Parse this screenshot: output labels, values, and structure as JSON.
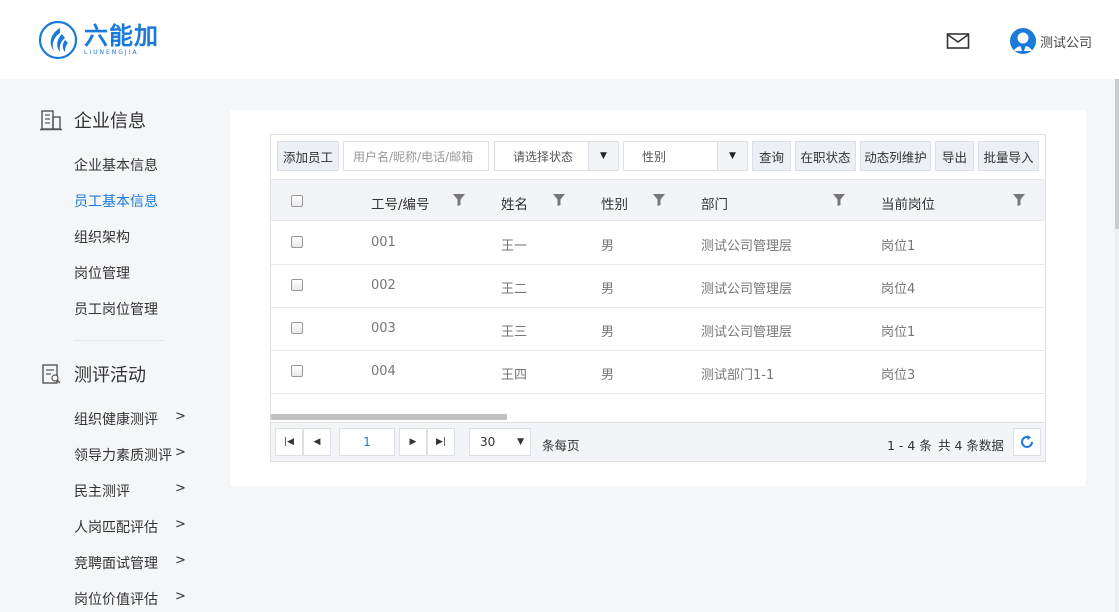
{
  "header": {
    "logo_cn": "六能加",
    "logo_en": "LIUNENGJIA",
    "user_name": "测试公司"
  },
  "sidebar": {
    "sections": [
      {
        "title": "企业信息",
        "icon": "building-icon"
      },
      {
        "title": "测评活动",
        "icon": "document-icon"
      }
    ],
    "company_items": [
      "企业基本信息",
      "员工基本信息",
      "组织架构",
      "岗位管理",
      "员工岗位管理"
    ],
    "active_item": "员工基本信息",
    "activity_items": [
      "组织健康测评",
      "领导力素质测评",
      "民主测评",
      "人岗匹配评估",
      "竞聘面试管理",
      "岗位价值评估"
    ]
  },
  "toolbar": {
    "add_employee": "添加员工",
    "search_placeholder": "用户名/昵称/电话/邮箱",
    "status_select": "请选择状态",
    "gender_select": "性别",
    "query": "查询",
    "employment_status": "在职状态",
    "dynamic_columns": "动态列维护",
    "export": "导出",
    "bulk_import": "批量导入"
  },
  "table": {
    "columns": [
      "工号/编号",
      "姓名",
      "性别",
      "部门",
      "当前岗位"
    ],
    "rows": [
      {
        "id": "001",
        "name": "王一",
        "gender": "男",
        "dept": "测试公司管理层",
        "position": "岗位1"
      },
      {
        "id": "002",
        "name": "王二",
        "gender": "男",
        "dept": "测试公司管理层",
        "position": "岗位4"
      },
      {
        "id": "003",
        "name": "王三",
        "gender": "男",
        "dept": "测试公司管理层",
        "position": "岗位1"
      },
      {
        "id": "004",
        "name": "王四",
        "gender": "男",
        "dept": "测试部门1-1",
        "position": "岗位3"
      }
    ]
  },
  "pager": {
    "page": "1",
    "page_size": "30",
    "per_page_label": "条每页",
    "range": "1 - 4 条",
    "total": "共 4 条数据"
  },
  "colors": {
    "accent": "#1a7ad9",
    "background": "#f5f6f8"
  }
}
